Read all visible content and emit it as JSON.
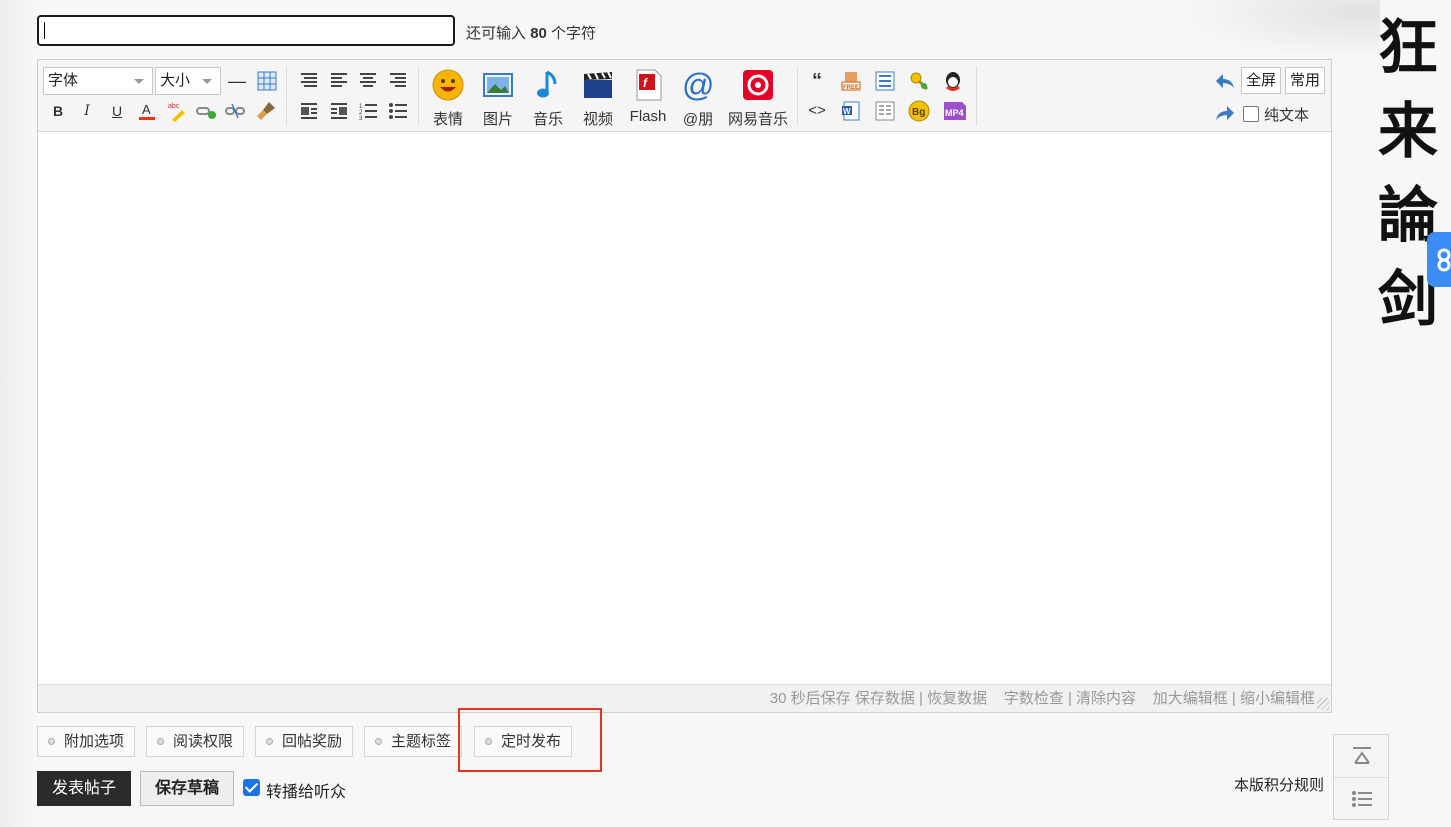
{
  "title_field": {
    "value": "",
    "hint_prefix": "还可输入",
    "hint_count": "80",
    "hint_suffix": "个字符"
  },
  "toolbar": {
    "font_select": "字体",
    "size_select": "大小",
    "format_icons": [
      "hr-icon",
      "table-icon",
      "bold-icon",
      "italic-icon",
      "underline-icon",
      "font-color-icon",
      "highlight-icon",
      "link-icon",
      "unlink-icon",
      "clear-format-icon"
    ],
    "align_icons": [
      "align-left-icon",
      "align-left2-icon",
      "align-center-icon",
      "align-right-icon",
      "float-left-icon",
      "float-right-icon",
      "ordered-list-icon",
      "unordered-list-icon"
    ],
    "media_buttons": [
      {
        "label": "表情",
        "icon": "emoji-icon"
      },
      {
        "label": "图片",
        "icon": "image-icon"
      },
      {
        "label": "音乐",
        "icon": "music-icon"
      },
      {
        "label": "视频",
        "icon": "video-icon"
      },
      {
        "label": "Flash",
        "icon": "flash-icon"
      },
      {
        "label": "@朋",
        "icon": "at-icon"
      },
      {
        "label": "网易音乐",
        "icon": "netease-music-icon"
      }
    ],
    "extra_icons": [
      "quote-icon",
      "free-icon",
      "hide-icon",
      "password-icon",
      "qq-icon",
      "code-icon",
      "word-icon",
      "page-icon",
      "bg-icon",
      "mp4-icon"
    ],
    "fullscreen_label": "全屏",
    "common_label": "常用",
    "plain_text_label": "纯文本"
  },
  "statusbar": {
    "autosave": "30 秒后保存",
    "save_data": "保存数据",
    "separator": "|",
    "restore_data": "恢复数据",
    "word_check": "字数检查",
    "clear_content": "清除内容",
    "enlarge": "加大编辑框",
    "shrink": "缩小编辑框"
  },
  "options": [
    "附加选项",
    "阅读权限",
    "回帖奖励",
    "主题标签",
    "定时发布"
  ],
  "actions": {
    "post_label": "发表帖子",
    "draft_label": "保存草稿",
    "relay_label": "转播给听众",
    "relay_checked": true,
    "rules_link": "本版积分规则"
  },
  "decor": {
    "calligraphy": [
      "狂",
      "来",
      "論",
      "剑"
    ]
  },
  "colors": {
    "highlight_border": "#e8341c",
    "post_bg": "#2b2b2b",
    "float_bg": "#3b8cf5"
  }
}
